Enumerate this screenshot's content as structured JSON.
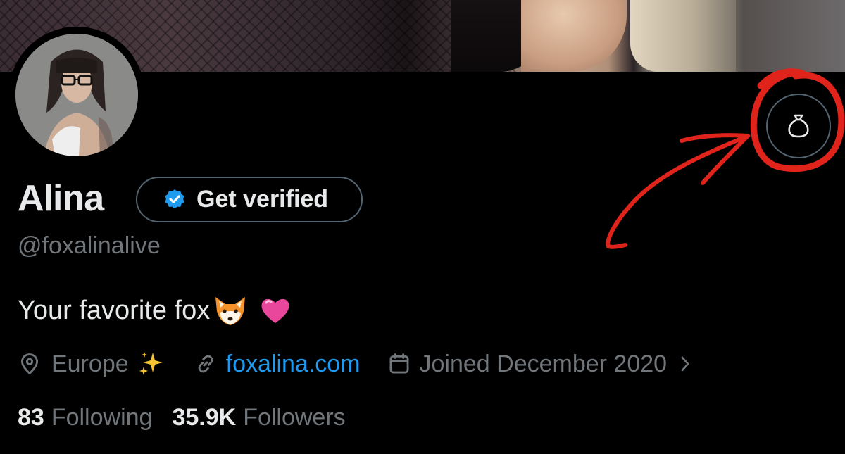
{
  "profile": {
    "display_name": "Alina",
    "handle": "@foxalinalive",
    "bio_text": "Your favorite fox",
    "bio_emoji": [
      "fox-face",
      "pink-heart"
    ],
    "verify_button_label": "Get verified",
    "location": "Europe",
    "location_emoji": "sparkles",
    "website": "foxalina.com",
    "joined": "Joined December 2020",
    "following_count": "83",
    "following_label": "Following",
    "followers_count": "35.9K",
    "followers_label": "Followers"
  },
  "icons": {
    "tip_button": "money-bag-icon",
    "verified": "verified-badge-icon",
    "location": "map-pin-icon",
    "link": "link-icon",
    "calendar": "calendar-icon",
    "chevron": "chevron-right-icon"
  },
  "colors": {
    "background": "#000000",
    "text_primary": "#e7e9ea",
    "text_secondary": "#71767b",
    "link": "#1d9bf0",
    "border": "#536471",
    "verified_badge": "#1d9bf0",
    "annotation": "#e0241b"
  }
}
